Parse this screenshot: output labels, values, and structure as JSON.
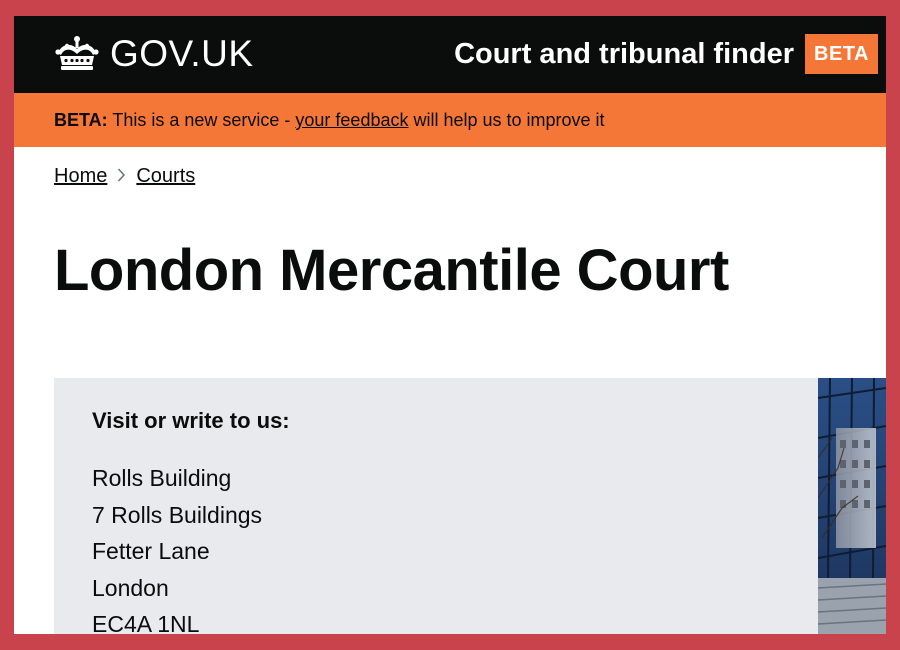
{
  "header": {
    "logo_text": "GOV.UK",
    "logo_icon": "crown-icon",
    "service_name": "Court and tribunal finder",
    "phase_tag": "BETA"
  },
  "beta_banner": {
    "label": "BETA:",
    "text_before": " This is a new service - ",
    "link_text": "your feedback",
    "text_after": " will help us to improve it"
  },
  "breadcrumb": {
    "items": [
      {
        "label": "Home"
      },
      {
        "label": "Courts"
      }
    ],
    "separator_icon": "chevron-right-icon"
  },
  "page": {
    "title": "London Mercantile Court"
  },
  "address": {
    "heading": "Visit or write to us:",
    "lines": [
      "Rolls Building",
      "7 Rolls Buildings",
      "Fetter Lane",
      "London",
      "EC4A 1NL"
    ]
  },
  "colors": {
    "header_bg": "#0b0c0c",
    "beta_orange": "#f47738",
    "panel_bg": "#e8eaed",
    "outer_border": "#c8434b"
  }
}
